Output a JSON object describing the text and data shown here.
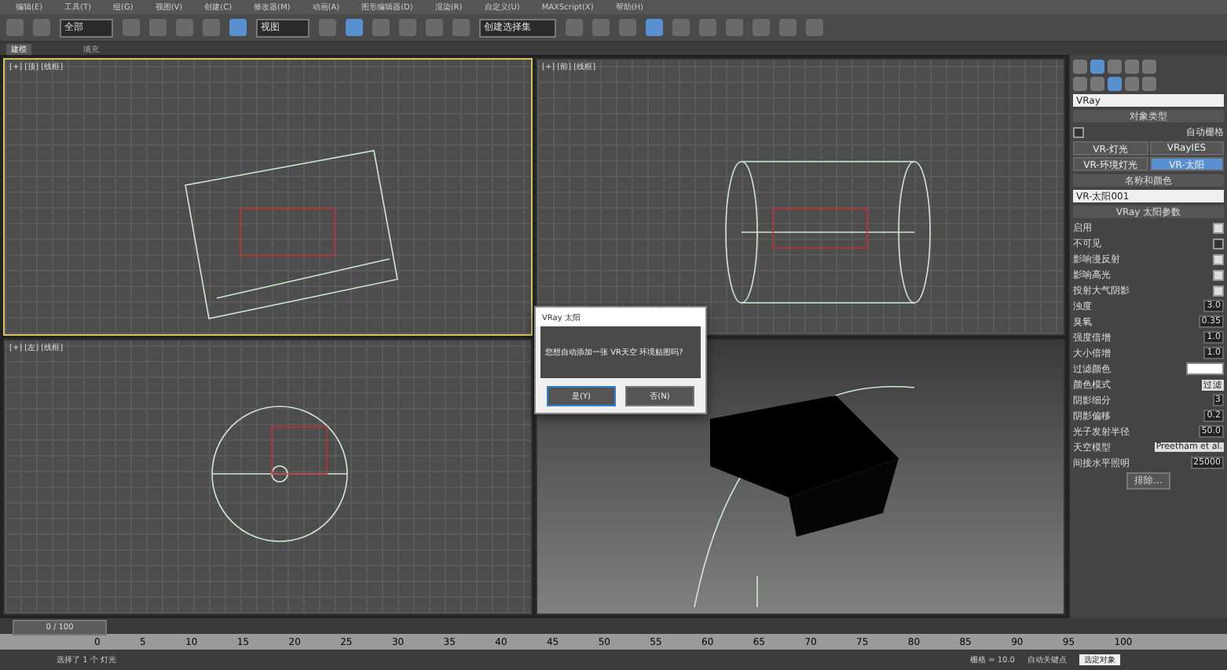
{
  "menu": [
    "编辑(E)",
    "工具(T)",
    "组(G)",
    "视图(V)",
    "创建(C)",
    "修改器(M)",
    "动画(A)",
    "图形编辑器(D)",
    "渲染(R)",
    "自定义(U)",
    "MAXScript(X)",
    "帮助(H)"
  ],
  "toolbar": {
    "filter": "全部",
    "coord": "视图",
    "selection_set": "创建选择集"
  },
  "ribbon_tabs": [
    {
      "label": "建模",
      "selected": true
    },
    {
      "label": "填充",
      "selected": false
    }
  ],
  "viewports": [
    {
      "label": "[+] [顶] [线框]",
      "kind": "top",
      "active": true
    },
    {
      "label": "[+] [前] [线框]",
      "kind": "front",
      "active": false
    },
    {
      "label": "[+] [左] [线框]",
      "kind": "left",
      "active": false
    },
    {
      "kind": "persp",
      "active": false
    }
  ],
  "dialog": {
    "title": "VRay 太阳",
    "message": "您想自动添加一张 VR天空 环境贴图吗?",
    "buttons": [
      {
        "label": "是(Y)",
        "selected": true
      },
      {
        "label": "否(N)",
        "selected": false
      }
    ]
  },
  "panel": {
    "category": "VRay",
    "object_type": {
      "title": "对象类型",
      "autogrid": "自动栅格",
      "autogrid_checked": false,
      "types": [
        {
          "label": "VR-灯光",
          "selected": false
        },
        {
          "label": "VRayIES",
          "selected": false
        },
        {
          "label": "VR-环境灯光",
          "selected": false
        },
        {
          "label": "VR-太阳",
          "selected": true
        }
      ]
    },
    "name_color": {
      "title": "名称和颜色",
      "name": "VR-太阳001"
    },
    "params_title": "VRay 太阳参数",
    "params": [
      {
        "kind": "checkbox",
        "label": "启用",
        "checked": true
      },
      {
        "kind": "checkbox",
        "label": "不可见",
        "checked": false
      },
      {
        "kind": "checkbox",
        "label": "影响漫反射",
        "checked": true
      },
      {
        "kind": "checkbox",
        "label": "影响高光",
        "checked": true
      },
      {
        "kind": "checkbox",
        "label": "投射大气阴影",
        "checked": true
      },
      {
        "kind": "spinner",
        "label": "浊度",
        "value": "3.0"
      },
      {
        "kind": "spinner",
        "label": "臭氧",
        "value": "0.35"
      },
      {
        "kind": "spinner",
        "label": "强度倍增",
        "value": "1.0"
      },
      {
        "kind": "spinner",
        "label": "大小倍增",
        "value": "1.0"
      },
      {
        "kind": "color",
        "label": "过滤颜色"
      },
      {
        "kind": "dropdown",
        "label": "颜色模式",
        "value": "过滤"
      },
      {
        "kind": "spinner",
        "label": "阴影细分",
        "value": "3"
      },
      {
        "kind": "spinner",
        "label": "阴影偏移",
        "value": "0.2"
      },
      {
        "kind": "spinner",
        "label": "光子发射半径",
        "value": "50.0"
      },
      {
        "kind": "dropdown",
        "label": "天空模型",
        "value": "Preetham et al."
      },
      {
        "kind": "spinner",
        "label": "间接水平照明",
        "value": "25000"
      }
    ],
    "exclude": "排除..."
  },
  "time_slider": {
    "frame": "0 / 100",
    "level": 0
  },
  "track_ticks": [
    "0",
    "5",
    "10",
    "15",
    "20",
    "25",
    "30",
    "35",
    "40",
    "45",
    "50",
    "55",
    "60",
    "65",
    "70",
    "75",
    "80",
    "85",
    "90",
    "95",
    "100"
  ],
  "status": {
    "message": "选择了 1 个 灯光",
    "grid": "栅格 = 10.0",
    "autokey": "自动关键点",
    "key_filter": "选定对象"
  }
}
